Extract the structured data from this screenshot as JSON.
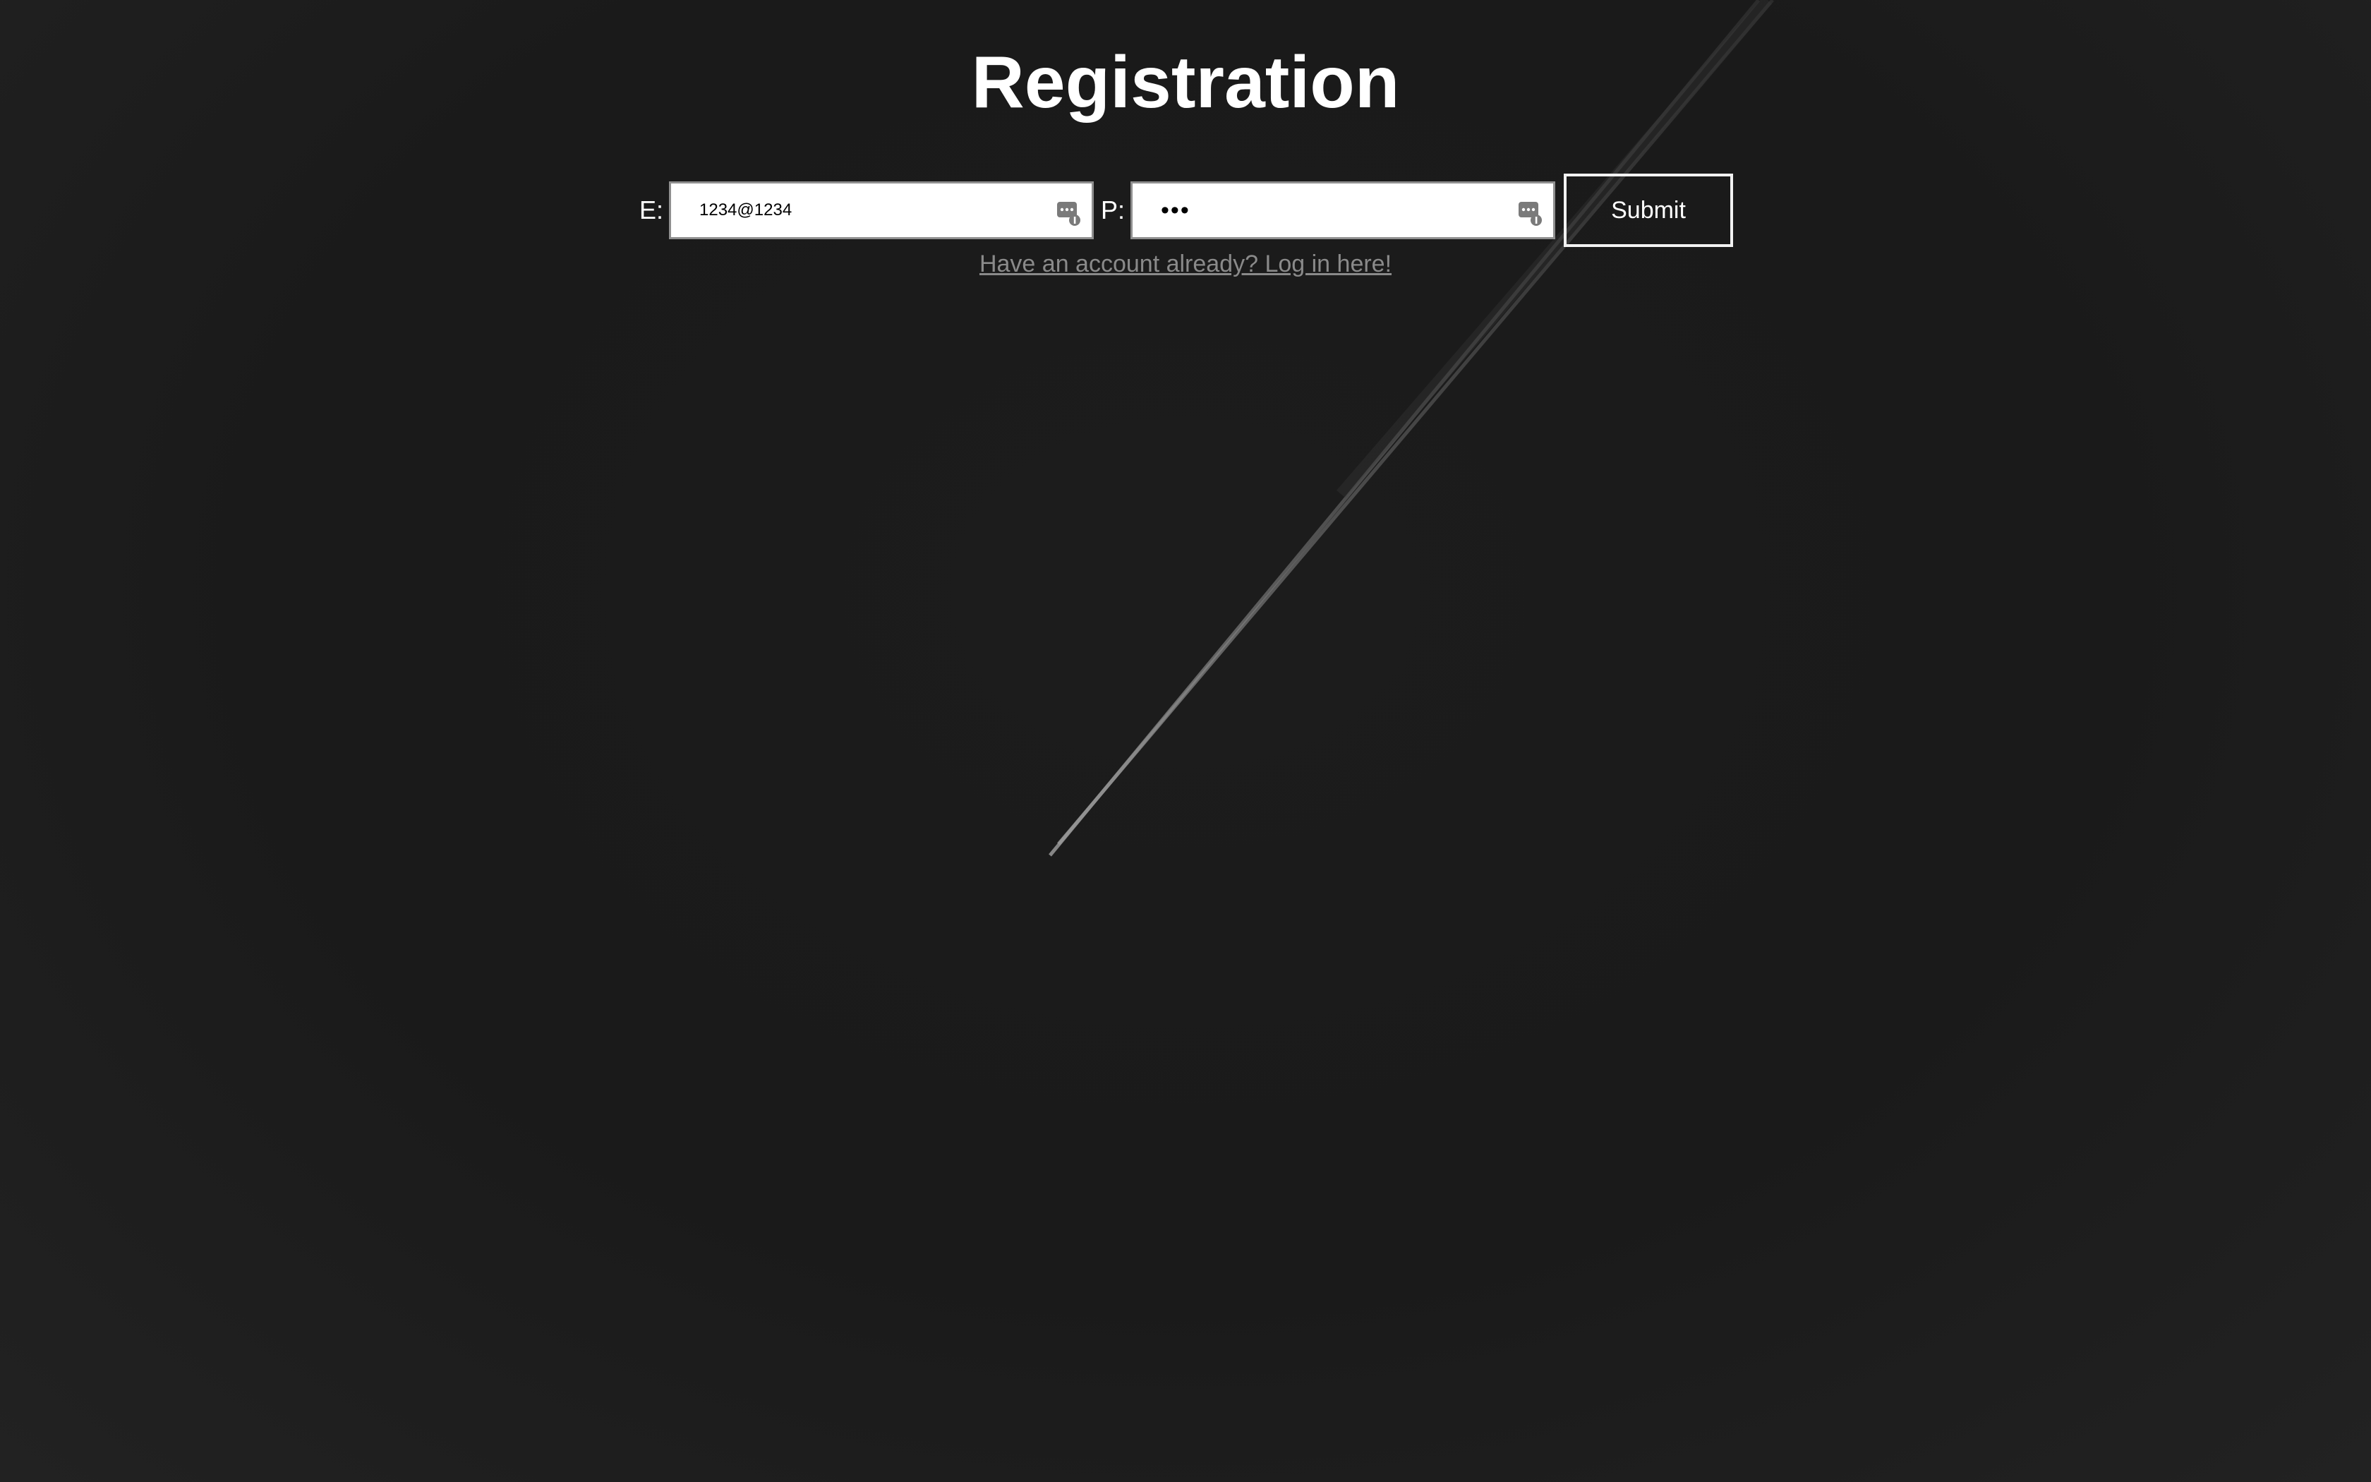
{
  "page": {
    "title": "Registration"
  },
  "form": {
    "email_label": "E:",
    "email_value": "1234@1234",
    "password_label": "P:",
    "password_value": "123",
    "submit_label": "Submit"
  },
  "login_link": {
    "text": "Have an account already? Log in here!"
  },
  "icons": {
    "password_manager": "password-manager-key-icon",
    "background": "contrail-night-sky"
  },
  "colors": {
    "background": "#1b1b1b",
    "text": "#ffffff",
    "link": "#8a8a8a",
    "input_border": "#8f8f8f",
    "button_border": "#f2f2f2"
  }
}
